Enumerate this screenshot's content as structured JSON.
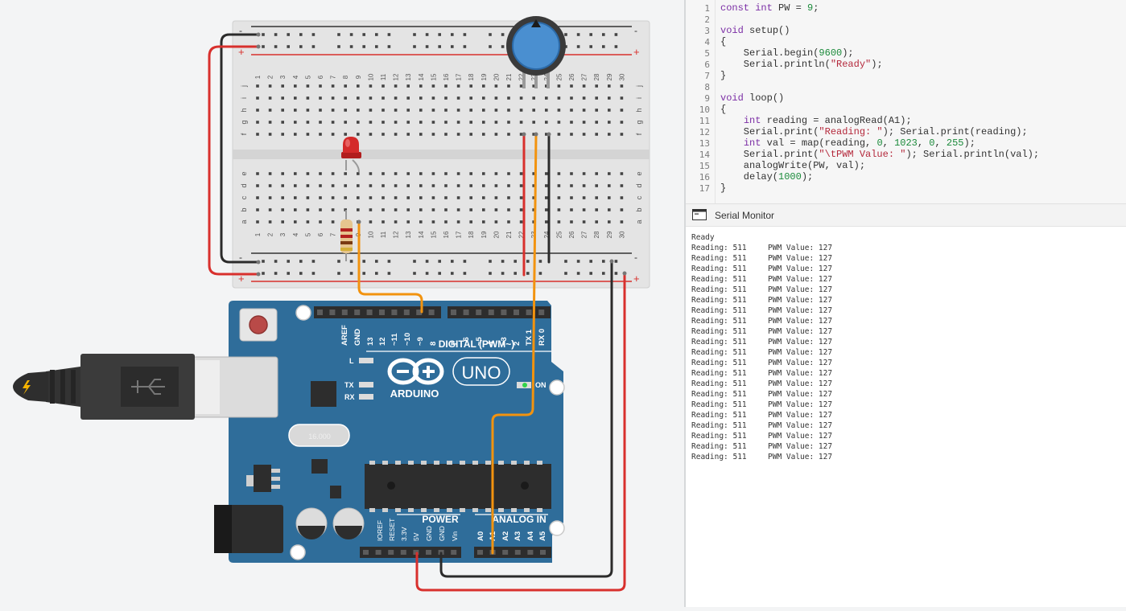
{
  "code": {
    "lines": [
      [
        [
          "kw",
          "const int"
        ],
        [
          "t",
          " PW = "
        ],
        [
          "num",
          "9"
        ],
        [
          "t",
          ";"
        ]
      ],
      [],
      [
        [
          "kw",
          "void"
        ],
        [
          "t",
          " setup()"
        ]
      ],
      [
        [
          "t",
          "{"
        ]
      ],
      [
        [
          "t",
          "    Serial.begin("
        ],
        [
          "num",
          "9600"
        ],
        [
          "t",
          ");"
        ]
      ],
      [
        [
          "t",
          "    Serial.println("
        ],
        [
          "str",
          "\"Ready\""
        ],
        [
          "t",
          ");"
        ]
      ],
      [
        [
          "t",
          "}"
        ]
      ],
      [],
      [
        [
          "kw",
          "void"
        ],
        [
          "t",
          " loop()"
        ]
      ],
      [
        [
          "t",
          "{"
        ]
      ],
      [
        [
          "t",
          "    "
        ],
        [
          "kw",
          "int"
        ],
        [
          "t",
          " reading = analogRead(A1);"
        ]
      ],
      [
        [
          "t",
          "    Serial.print("
        ],
        [
          "str",
          "\"Reading: \""
        ],
        [
          "t",
          "); Serial.print(reading);"
        ]
      ],
      [
        [
          "t",
          "    "
        ],
        [
          "kw",
          "int"
        ],
        [
          "t",
          " val = map(reading, "
        ],
        [
          "num",
          "0"
        ],
        [
          "t",
          ", "
        ],
        [
          "num",
          "1023"
        ],
        [
          "t",
          ", "
        ],
        [
          "num",
          "0"
        ],
        [
          "t",
          ", "
        ],
        [
          "num",
          "255"
        ],
        [
          "t",
          ");"
        ]
      ],
      [
        [
          "t",
          "    Serial.print("
        ],
        [
          "str",
          "\"\\tPWM Value: \""
        ],
        [
          "t",
          "); Serial.println(val);"
        ]
      ],
      [
        [
          "t",
          "    analogWrite(PW, val);"
        ]
      ],
      [
        [
          "t",
          "    delay("
        ],
        [
          "num",
          "1000"
        ],
        [
          "t",
          ");"
        ]
      ],
      [
        [
          "t",
          "}"
        ]
      ]
    ]
  },
  "serial_monitor": {
    "title": "Serial Monitor",
    "first_line": "Ready",
    "reading_label": "Reading: 511",
    "pwm_label": "PWM Value: 127",
    "repeat_count": 21
  },
  "breadboard": {
    "top_rail_minus": "-",
    "top_rail_plus": "+",
    "columns_top": [
      "1",
      "2",
      "3",
      "4",
      "5",
      "6",
      "7",
      "8",
      "9",
      "10",
      "11",
      "12",
      "13",
      "14",
      "15",
      "16",
      "17",
      "18",
      "19",
      "20",
      "21",
      "22",
      "23",
      "24",
      "25",
      "26",
      "27",
      "28",
      "29",
      "30"
    ],
    "rows_top": [
      "j",
      "i",
      "h",
      "g",
      "f"
    ],
    "rows_bottom": [
      "e",
      "d",
      "c",
      "b",
      "a"
    ]
  },
  "arduino": {
    "brand": "ARDUINO",
    "model": "UNO",
    "digital_label": "DIGITAL (PWM~)",
    "power_label": "POWER",
    "analog_label": "ANALOG IN",
    "crystal_label": "16.000",
    "on_label": "ON",
    "l_label": "L",
    "tx_label": "TX",
    "rx_label": "RX",
    "digital_pins": [
      "AREF",
      "GND",
      "13",
      "12",
      "~11",
      "~10",
      "~9",
      "8",
      "7",
      "~6",
      "~5",
      "4",
      "~3",
      "2",
      "TX 1",
      "RX 0"
    ],
    "power_pins": [
      "IOREF",
      "RESET",
      "3.3V",
      "5V",
      "GND",
      "GND",
      "Vin"
    ],
    "analog_pins": [
      "A0",
      "A1",
      "A2",
      "A3",
      "A4",
      "A5"
    ]
  },
  "colors": {
    "board_blue": "#2f6d9a",
    "breadboard": "#e4e4e4",
    "wire_red": "#d8302d",
    "wire_black": "#2b2b2b",
    "wire_orange": "#f2930f",
    "led_red": "#d42a2a",
    "pot_knob": "#4a8fd0"
  }
}
